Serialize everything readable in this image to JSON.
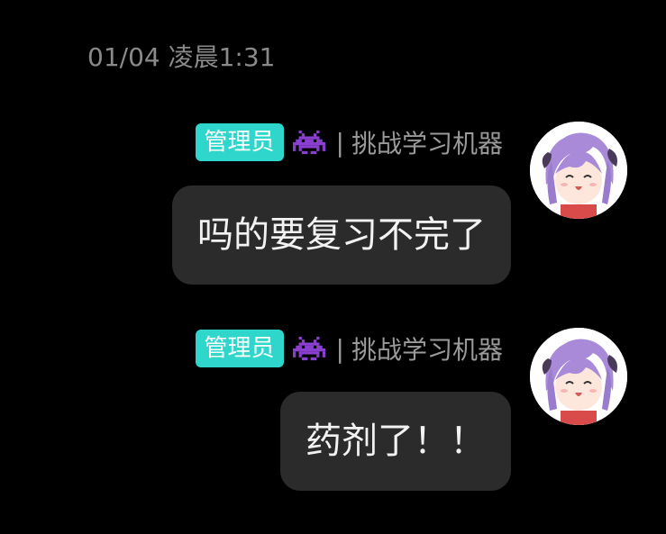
{
  "chat": {
    "timestamp": "01/04 凌晨1:31",
    "messages": [
      {
        "role_badge": "管理员",
        "badge_icon": "space-invader-icon",
        "separator": "|",
        "sender_name": "挑战学习机器",
        "text": "吗的要复习不完了"
      },
      {
        "role_badge": "管理员",
        "badge_icon": "space-invader-icon",
        "separator": "|",
        "sender_name": "挑战学习机器",
        "text": "药剂了！！"
      }
    ]
  },
  "colors": {
    "background": "#000000",
    "badge": "#2fd6cc",
    "bubble": "#2b2b2b",
    "icon": "#8a3fd0",
    "meta_text": "#9a9a9a"
  }
}
